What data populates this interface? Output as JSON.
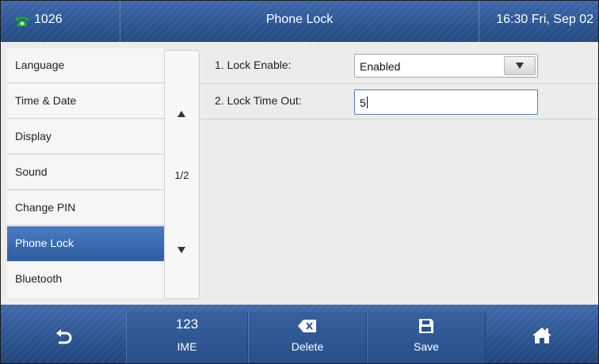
{
  "title_bar": {
    "account": "1026",
    "title": "Phone Lock",
    "clock": "16:30 Fri, Sep 02"
  },
  "menu": {
    "items": [
      {
        "label": "Language"
      },
      {
        "label": "Time & Date"
      },
      {
        "label": "Display"
      },
      {
        "label": "Sound"
      },
      {
        "label": "Change PIN"
      },
      {
        "label": "Phone Lock",
        "selected": true
      },
      {
        "label": "Bluetooth"
      }
    ],
    "page_indicator": "1/2"
  },
  "settings": {
    "lock_enable": {
      "label": "1. Lock Enable:",
      "value": "Enabled"
    },
    "lock_time_out": {
      "label": "2. Lock Time Out:",
      "value": "5"
    }
  },
  "softkeys": {
    "back_icon": "back-arrow-icon",
    "ime": {
      "top": "123",
      "label": "IME"
    },
    "delete": {
      "icon": "backspace-icon",
      "label": "Delete"
    },
    "save": {
      "icon": "floppy-disk-icon",
      "label": "Save"
    },
    "home_icon": "home-icon"
  },
  "colors": {
    "bar_blue": "#2b5592",
    "selected_item": "#3d6cb0",
    "phone_icon_green": "#2fb34a"
  }
}
